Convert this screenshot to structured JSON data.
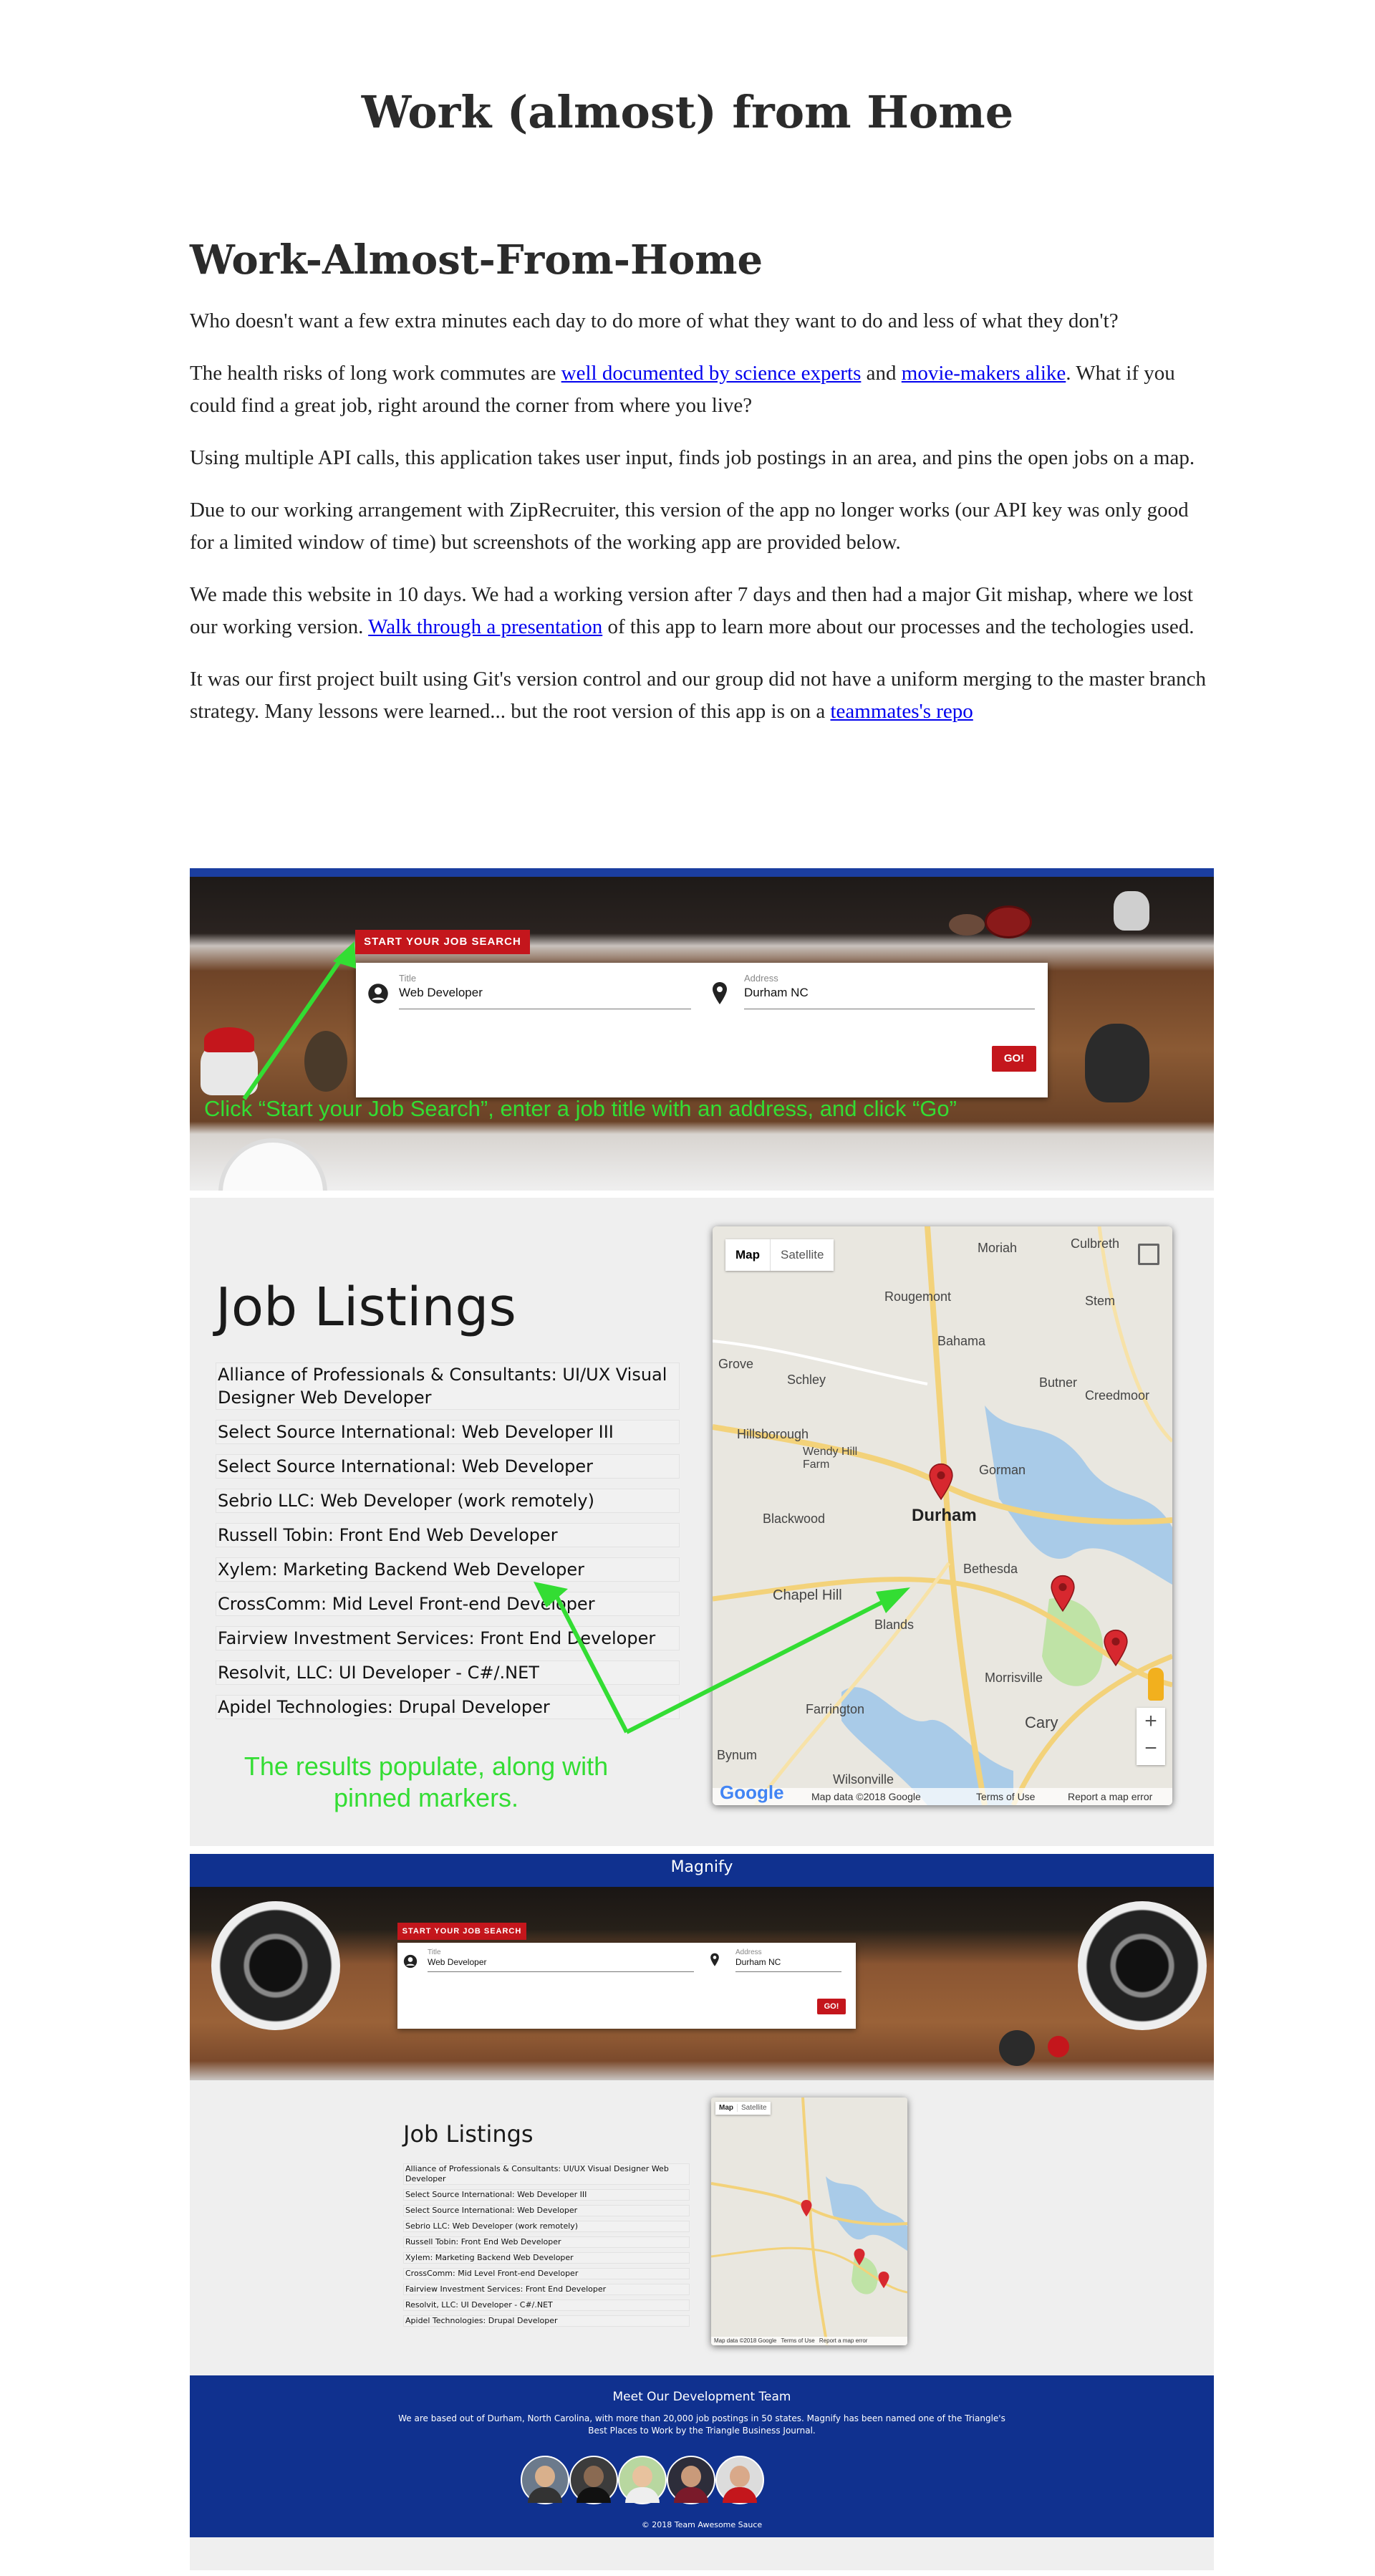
{
  "page": {
    "title": "Work (almost) from Home",
    "heading": "Work-Almost-From-Home",
    "p1": "Who doesn't want a few extra minutes each day to do more of what they want to do and less of what they don't?",
    "p2": {
      "pre": "The health risks of long work commutes are ",
      "link1": "well documented by science experts",
      "mid": " and ",
      "link2": "movie-makers alike",
      "post": ". What if you could find a great job, right around the corner from where you live?"
    },
    "p3": "Using multiple API calls, this application takes user input, finds job postings in an area, and pins the open jobs on a map.",
    "p4": "Due to our working arrangement with ZipRecruiter, this version of the app no longer works (our API key was only good for a limited window of time) but screenshots of the working app are provided below.",
    "p5": {
      "pre": "We made this website in 10 days. We had a working version after 7 days and then had a major Git mishap, where we lost our working version. ",
      "link": "Walk through a presentation",
      "post": " of this app to learn more about our processes and the techologies used."
    },
    "p6": {
      "pre": "It was our first project built using Git's version control and our group did not have a uniform merging to the master branch strategy. Many lessons were learned... but the root version of this app is on a ",
      "link": "teammates's repo"
    }
  },
  "search": {
    "start_label": "START YOUR JOB SEARCH",
    "title_caption": "Title",
    "title_value": "Web Developer",
    "address_caption": "Address",
    "address_value": "Durham NC",
    "go_label": "GO!"
  },
  "annotations": {
    "step1": "Click “Start your Job Search”, enter a job title with an address, and click “Go”",
    "step2": "The results populate, along with pinned markers."
  },
  "listings": {
    "title": "Job Listings",
    "items": [
      "Alliance of Professionals & Consultants: UI/UX Visual Designer Web Developer",
      "Select Source International: Web Developer III",
      "Select Source International: Web Developer",
      "Sebrio LLC: Web Developer (work remotely)",
      "Russell Tobin: Front End Web Developer",
      "Xylem: Marketing Backend Web Developer",
      "CrossComm: Mid Level Front-end Developer",
      "Fairview Investment Services: Front End Developer",
      "Resolvit, LLC: UI Developer - C#/.NET",
      "Apidel Technologies: Drupal Developer"
    ]
  },
  "map": {
    "tab_map": "Map",
    "tab_satellite": "Satellite",
    "places": [
      "Moriah",
      "Culbreth",
      "Rougemont",
      "Stem",
      "Bahama",
      "Grove",
      "Schley",
      "Butner",
      "Creedmoor",
      "Hillsborough",
      "Gorman",
      "Durham",
      "Blackwood",
      "Bethesda",
      "Chapel Hill",
      "Blands",
      "Morrisville",
      "Farrington",
      "Cary",
      "Bynum",
      "Wilsonville",
      "Wendy Hill Farm"
    ],
    "google": "Google",
    "map_data": "Map data ©2018 Google",
    "terms": "Terms of Use",
    "report": "Report a map error"
  },
  "nav": {
    "brand": "Magnify"
  },
  "footer": {
    "heading": "Meet Our Development Team",
    "text": "We are based out of Durham, North Carolina, with more than 20,000 job postings in 50 states. Magnify has been named one of the Triangle's Best Places to Work by the Triangle Business Journal.",
    "copyright": "© 2018 Team Awesome Sauce"
  },
  "colors": {
    "brand_blue": "#10318f",
    "accent_red": "#c4161c",
    "annotation_green": "#33dd33",
    "link": "#0000ee"
  }
}
